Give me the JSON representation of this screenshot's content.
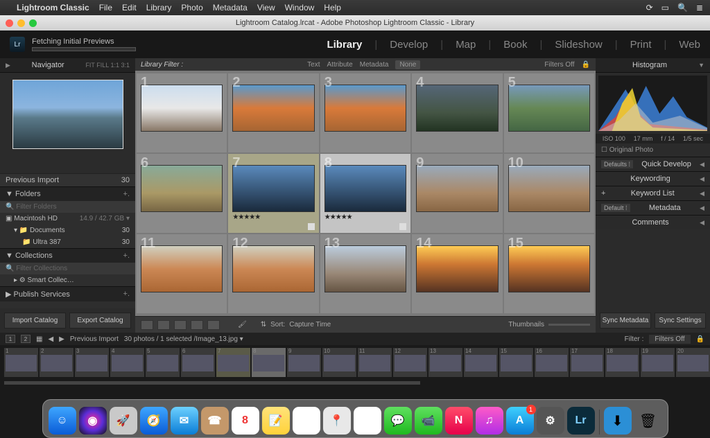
{
  "menubar": {
    "apple": "",
    "app": "Lightroom Classic",
    "items": [
      "File",
      "Edit",
      "Library",
      "Photo",
      "Metadata",
      "View",
      "Window",
      "Help"
    ]
  },
  "titlebar": {
    "title": "Lightroom Catalog.lrcat - Adobe Photoshop Lightroom Classic - Library"
  },
  "topbar": {
    "logo": "Lr",
    "status": "Fetching Initial Previews",
    "modules": [
      "Library",
      "Develop",
      "Map",
      "Book",
      "Slideshow",
      "Print",
      "Web"
    ],
    "active_module": "Library"
  },
  "left": {
    "navigator": {
      "title": "Navigator",
      "modes": "FIT   FILL   1:1   3:1"
    },
    "prev_import": {
      "label": "Previous Import",
      "count": "30"
    },
    "folders": {
      "title": "Folders",
      "filter_placeholder": "Filter Folders",
      "volume": {
        "name": "Macintosh HD",
        "stats": "14.9 / 42.7 GB"
      },
      "items": [
        {
          "name": "Documents",
          "count": "30"
        },
        {
          "name": "Ultra 387",
          "count": "30"
        }
      ]
    },
    "collections": {
      "title": "Collections",
      "filter_placeholder": "Filter Collections",
      "smart": "Smart Collec…"
    },
    "publish": {
      "title": "Publish Services"
    },
    "buttons": {
      "import": "Import Catalog",
      "export": "Export Catalog"
    }
  },
  "center": {
    "filterbar": {
      "title": "Library Filter :",
      "text": "Text",
      "attribute": "Attribute",
      "metadata": "Metadata",
      "none": "None",
      "filters_off": "Filters Off"
    },
    "thumbs": [
      {
        "n": "1",
        "cls": "tg1"
      },
      {
        "n": "2",
        "cls": "tg2"
      },
      {
        "n": "3",
        "cls": "tg2"
      },
      {
        "n": "4",
        "cls": "tg4"
      },
      {
        "n": "5",
        "cls": "tg5"
      },
      {
        "n": "6",
        "cls": "tg6"
      },
      {
        "n": "7",
        "cls": "tg7",
        "sel": 1,
        "rating": "★★★★★"
      },
      {
        "n": "8",
        "cls": "tg7",
        "sel": 2,
        "rating": "★★★★★"
      },
      {
        "n": "9",
        "cls": "tg8"
      },
      {
        "n": "10",
        "cls": "tg8"
      },
      {
        "n": "11",
        "cls": "tg9"
      },
      {
        "n": "12",
        "cls": "tg9"
      },
      {
        "n": "13",
        "cls": "tg10"
      },
      {
        "n": "14",
        "cls": "tg11"
      },
      {
        "n": "15",
        "cls": "tg11"
      }
    ],
    "toolbar": {
      "sort_label": "Sort:",
      "sort_value": "Capture Time",
      "thumbnails": "Thumbnails"
    }
  },
  "right": {
    "histogram": {
      "title": "Histogram",
      "iso": "ISO 100",
      "focal": "17 mm",
      "aperture": "f / 14",
      "shutter": "1/5 sec",
      "orig": "Original Photo"
    },
    "sections": [
      {
        "preset": "Defaults",
        "label": "Quick Develop"
      },
      {
        "label": "Keywording"
      },
      {
        "plus": "+",
        "label": "Keyword List"
      },
      {
        "preset": "Default",
        "label": "Metadata"
      },
      {
        "label": "Comments"
      }
    ],
    "buttons": {
      "sync_meta": "Sync Metadata",
      "sync_settings": "Sync Settings"
    }
  },
  "filmstrip": {
    "monitors": [
      "1",
      "2"
    ],
    "path": "Previous Import",
    "info": "30 photos / 1 selected /Image_13.jpg ▾",
    "filter_label": "Filter :",
    "filter_value": "Filters Off",
    "items": [
      1,
      2,
      3,
      4,
      5,
      6,
      7,
      8,
      9,
      10,
      11,
      12,
      13,
      14,
      15,
      16,
      17,
      18,
      19,
      20
    ]
  },
  "dock": {
    "icons": [
      {
        "name": "finder",
        "bg": "linear-gradient(#3ea6ff,#0a5bd6)",
        "glyph": "☺"
      },
      {
        "name": "siri",
        "bg": "radial-gradient(circle,#ff2d95,#5b2dd6,#111)",
        "glyph": "◉"
      },
      {
        "name": "launchpad",
        "bg": "#c9c9c9",
        "glyph": "🚀"
      },
      {
        "name": "safari",
        "bg": "linear-gradient(#3ea6ff,#0a5bd6)",
        "glyph": "🧭"
      },
      {
        "name": "mail",
        "bg": "linear-gradient(#6cd0ff,#0a7dd6)",
        "glyph": "✉"
      },
      {
        "name": "contacts",
        "bg": "#c4986a",
        "glyph": "☎"
      },
      {
        "name": "calendar",
        "bg": "#fff",
        "glyph": "8"
      },
      {
        "name": "notes",
        "bg": "linear-gradient(#ffe37a,#ffd23a)",
        "glyph": "📝"
      },
      {
        "name": "reminders",
        "bg": "#fff",
        "glyph": "☑"
      },
      {
        "name": "maps",
        "bg": "#e8e8e8",
        "glyph": "📍"
      },
      {
        "name": "photos",
        "bg": "#fff",
        "glyph": "✿"
      },
      {
        "name": "messages",
        "bg": "linear-gradient(#5fe05f,#1fb91f)",
        "glyph": "💬"
      },
      {
        "name": "facetime",
        "bg": "linear-gradient(#5fe05f,#1fb91f)",
        "glyph": "📹"
      },
      {
        "name": "news",
        "bg": "linear-gradient(#ff4d6a,#e6004a)",
        "glyph": "N"
      },
      {
        "name": "itunes",
        "bg": "linear-gradient(#ff5bc7,#b02de6)",
        "glyph": "♫"
      },
      {
        "name": "appstore",
        "bg": "linear-gradient(#3ed0ff,#0a7dd6)",
        "glyph": "A",
        "badge": "1"
      },
      {
        "name": "preferences",
        "bg": "#555",
        "glyph": "⚙"
      },
      {
        "name": "lightroom",
        "bg": "#0b2b3a",
        "glyph": "Lr"
      }
    ],
    "tray": [
      {
        "name": "downloads",
        "bg": "#2b8fd6",
        "glyph": "⬇"
      },
      {
        "name": "trash",
        "bg": "transparent",
        "glyph": "🗑"
      }
    ]
  }
}
